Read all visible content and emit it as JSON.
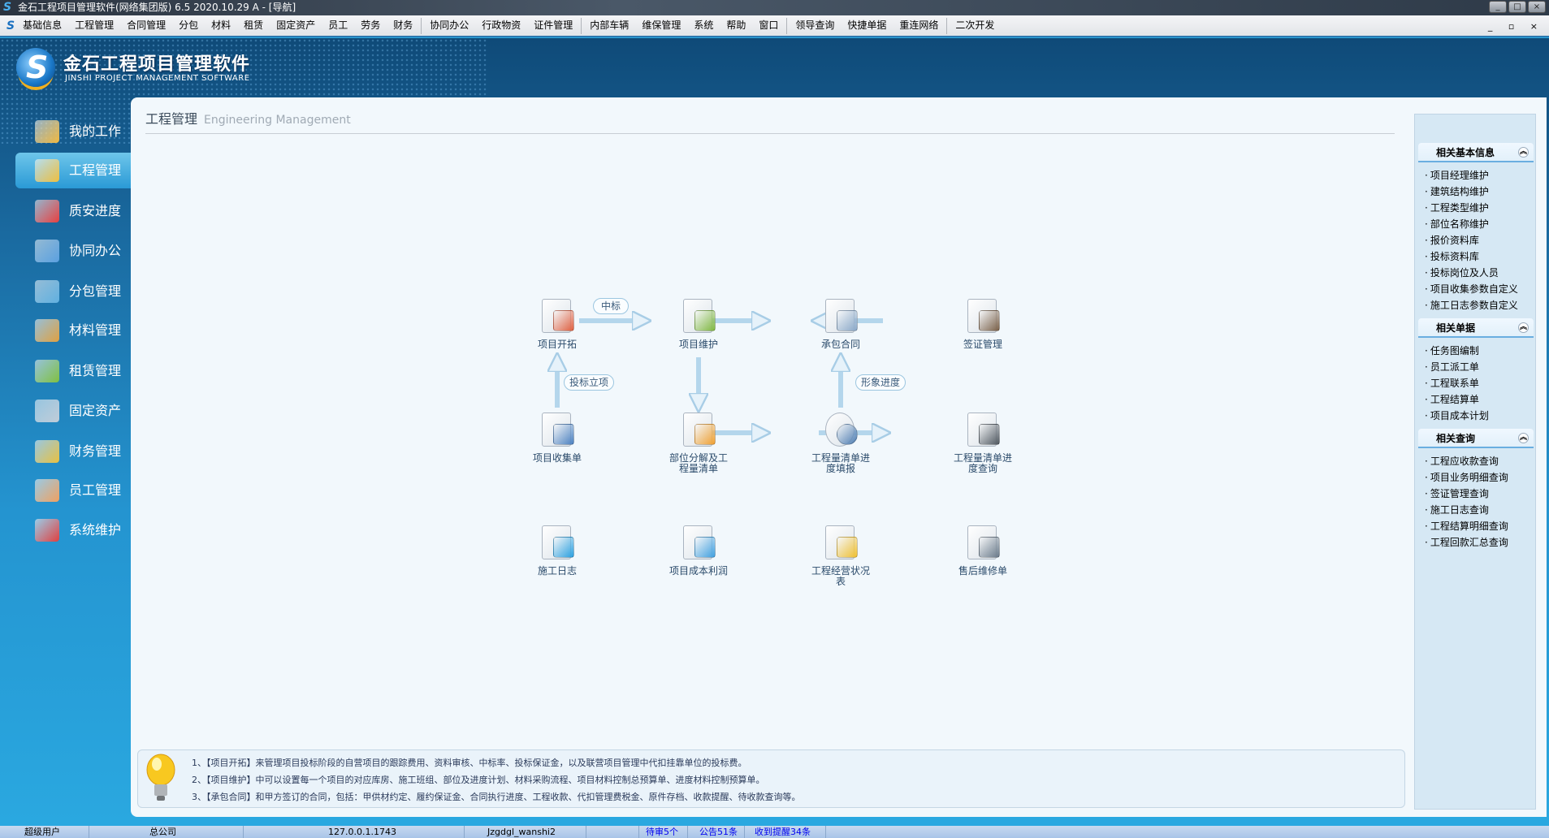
{
  "window": {
    "title": "金石工程项目管理软件(网络集团版) 6.5  2020.10.29 A - [导航]"
  },
  "menu": [
    "基础信息",
    "工程管理",
    "合同管理",
    "分包",
    "材料",
    "租赁",
    "固定资产",
    "员工",
    "劳务",
    "财务",
    "|",
    "协同办公",
    "行政物资",
    "证件管理",
    "|",
    "内部车辆",
    "维保管理",
    "系统",
    "帮助",
    "窗口",
    "|",
    "领导查询",
    "快捷单据",
    "重连网络",
    "|",
    "二次开发"
  ],
  "brand": {
    "cn": "金石工程项目管理软件",
    "en": "JINSHI PROJECT MANAGEMENT SOFTWARE"
  },
  "nav": [
    {
      "label": "我的工作",
      "color": "#f0b840"
    },
    {
      "label": "工程管理",
      "color": "#f0c040",
      "active": true
    },
    {
      "label": "质安进度",
      "color": "#e84040"
    },
    {
      "label": "协同办公",
      "color": "#5aa0e0"
    },
    {
      "label": "分包管理",
      "color": "#60b0e0"
    },
    {
      "label": "材料管理",
      "color": "#e0a040"
    },
    {
      "label": "租赁管理",
      "color": "#80c040"
    },
    {
      "label": "固定资产",
      "color": "#c0ccd8"
    },
    {
      "label": "财务管理",
      "color": "#e8c040"
    },
    {
      "label": "员工管理",
      "color": "#f0a060"
    },
    {
      "label": "系统维护",
      "color": "#e04040"
    }
  ],
  "content": {
    "title": "工程管理",
    "subtitle": "Engineering Management"
  },
  "flow": {
    "nodes": [
      {
        "label": "项目开拓",
        "icon": "project-develop-icon",
        "color": "#e06040"
      },
      {
        "label": "项目维护",
        "icon": "project-maintain-icon",
        "color": "#80b840"
      },
      {
        "label": "承包合同",
        "icon": "contract-folder-icon",
        "color": "#8aa8c8"
      },
      {
        "label": "签证管理",
        "icon": "visa-stamp-icon",
        "color": "#7a6048"
      },
      {
        "label": "项目收集单",
        "icon": "notepad-icon",
        "color": "#4a80c0"
      },
      {
        "label": "部位分解及工程量清单",
        "icon": "blocks-icon",
        "color": "#f0a030"
      },
      {
        "label": "工程量清单进度填报",
        "icon": "clock-icon",
        "color": "#4a7ab0"
      },
      {
        "label": "工程量清单进度查询",
        "icon": "clock-doc-icon",
        "color": "#505860"
      },
      {
        "label": "施工日志",
        "icon": "books-icon",
        "color": "#2aa0e0"
      },
      {
        "label": "项目成本利润",
        "icon": "cost-doc-icon",
        "color": "#40a0e0"
      },
      {
        "label": "工程经营状况表",
        "icon": "coins-chart-icon",
        "color": "#f0c030"
      },
      {
        "label": "售后维修单",
        "icon": "support-icon",
        "color": "#6a7a8a"
      }
    ],
    "tags": {
      "win_bid": "中标",
      "bid_project": "投标立项",
      "progress": "形象进度"
    }
  },
  "notes": [
    "1、【项目开拓】来管理项目投标阶段的自营项目的跟踪费用、资料审核、中标率、投标保证金，以及联营项目管理中代扣挂靠单位的投标费。",
    "2、【项目维护】中可以设置每一个项目的对应库房、施工班组、部位及进度计划、材料采购流程、项目材料控制总预算单、进度材料控制预算单。",
    "3、【承包合同】和甲方签订的合同，包括：甲供材约定、履约保证金、合同执行进度、工程收款、代扣管理费税金、原件存档、收款提醒、待收款查询等。"
  ],
  "right": [
    {
      "title": "相关基本信息",
      "items": [
        "项目经理维护",
        "建筑结构维护",
        "工程类型维护",
        "部位名称维护",
        "报价资料库",
        "投标资料库",
        "投标岗位及人员",
        "项目收集参数自定义",
        "施工日志参数自定义"
      ]
    },
    {
      "title": "相关单据",
      "items": [
        "任务图编制",
        "员工派工单",
        "工程联系单",
        "工程结算单",
        "项目成本计划"
      ]
    },
    {
      "title": "相关查询",
      "items": [
        "工程应收款查询",
        "项目业务明细查询",
        "签证管理查询",
        "施工日志查询",
        "工程结算明细查询",
        "工程回款汇总查询"
      ]
    }
  ],
  "status": {
    "user": "超级用户",
    "company": "总公司",
    "server": "127.0.0.1.1743",
    "db": "Jzgdgl_wanshi2",
    "pending": "待审5个",
    "notice": "公告51条",
    "remind": "收到提醒34条"
  }
}
